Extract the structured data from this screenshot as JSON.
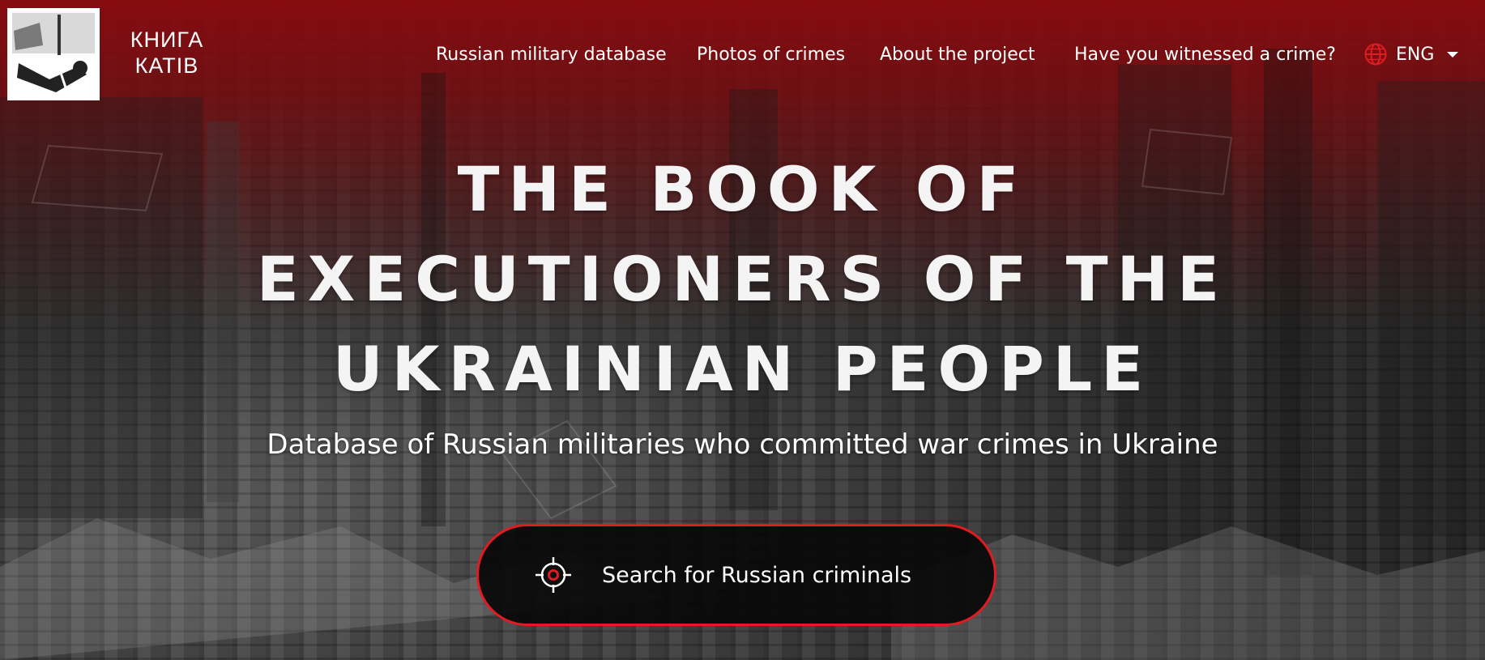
{
  "brand": {
    "line1": "КНИГА",
    "line2": "КАТІВ",
    "logo_icon": "hanged-figure-logo-icon"
  },
  "nav": {
    "items": [
      {
        "label": "Russian military database"
      },
      {
        "label": "Photos of crimes"
      },
      {
        "label": "About the project"
      },
      {
        "label": "Have you witnessed a crime?"
      }
    ]
  },
  "language": {
    "icon": "globe-icon",
    "selected": "ENG",
    "caret_icon": "caret-down-icon"
  },
  "hero": {
    "title_lines": [
      "THE BOOK OF",
      "EXECUTIONERS OF THE",
      "UKRAINIAN PEOPLE"
    ],
    "subtitle": "Database of Russian militaries who committed war crimes in Ukraine",
    "search_button": {
      "icon": "crosshair-target-icon",
      "label": "Search for Russian criminals"
    }
  },
  "colors": {
    "accent_red": "#e01b22",
    "header_red": "#8c0a0e",
    "button_bg": "#080808",
    "text": "#ffffff"
  }
}
